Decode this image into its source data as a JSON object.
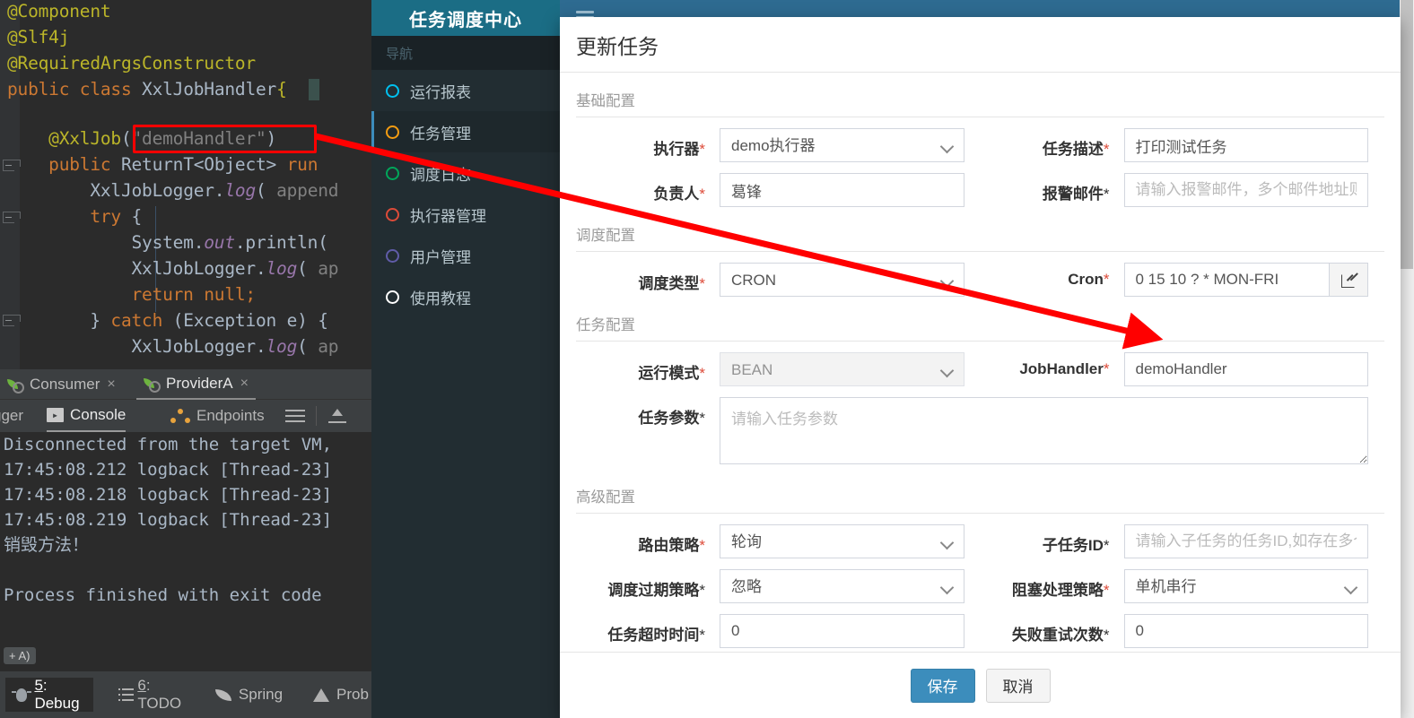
{
  "ide": {
    "code_lines": [
      "@Component",
      "@Slf4j",
      "@RequiredArgsConstructor",
      "public class XxlJobHandler{",
      "",
      "    @XxlJob(\"demoHandler\")",
      "    public ReturnT<Object> run",
      "        XxlJobLogger.log( append",
      "        try {",
      "            System.out.println(",
      "            XxlJobLogger.log( ap",
      "            return null;",
      "        } catch (Exception e) {",
      "            XxlJobLogger.log( ap"
    ],
    "highlighted_token": "\"demoHandler\"",
    "run_tabs": [
      {
        "label": "Consumer",
        "icon": "spring-leaf-icon",
        "active": false
      },
      {
        "label": "ProviderA",
        "icon": "spring-leaf-icon",
        "active": true
      }
    ],
    "tab_close_glyph": "×",
    "sub_tabs": [
      {
        "label": "gger",
        "icon": "",
        "active": false
      },
      {
        "label": "Console",
        "icon": "console-icon",
        "active": true
      },
      {
        "label": "Endpoints",
        "icon": "endpoints-icon",
        "active": false
      }
    ],
    "console_lines": [
      "Disconnected from the target VM,",
      "17:45:08.212 logback [Thread-23]",
      "17:45:08.218 logback [Thread-23]",
      "17:45:08.219 logback [Thread-23]",
      "销毁方法！",
      "",
      "Process finished with exit code"
    ],
    "hint_chip": "+ A)",
    "status_items": [
      {
        "num": "5",
        "label": ": Debug",
        "icon": "bug-icon",
        "active": true
      },
      {
        "num": "6",
        "label": ": TODO",
        "icon": "todo-icon",
        "active": false
      },
      {
        "num": "",
        "label": "Spring",
        "icon": "leaf-icon",
        "active": false
      },
      {
        "num": "",
        "label": "Prob",
        "icon": "warning-icon",
        "active": false
      }
    ]
  },
  "webapp": {
    "brand": "任务调度中心",
    "nav_header": "导航",
    "nav_items": [
      {
        "label": "运行报表",
        "color": "#00c0ef",
        "active": false
      },
      {
        "label": "任务管理",
        "color": "#f39c12",
        "active": true
      },
      {
        "label": "调度日志",
        "color": "#00a65a",
        "active": false
      },
      {
        "label": "执行器管理",
        "color": "#dd4b39",
        "active": false
      },
      {
        "label": "用户管理",
        "color": "#605ca8",
        "active": false
      },
      {
        "label": "使用教程",
        "color": "#ffffff",
        "active": false
      }
    ],
    "menu_icon": "hamburger-icon"
  },
  "modal": {
    "title": "更新任务",
    "sections": [
      {
        "legend": "基础配置"
      },
      {
        "legend": "调度配置"
      },
      {
        "legend": "任务配置"
      },
      {
        "legend": "高级配置"
      }
    ],
    "fields": {
      "executor": {
        "label": "执行器",
        "req": "*",
        "req_red": true,
        "value": "demo执行器"
      },
      "job_desc": {
        "label": "任务描述",
        "req": "*",
        "req_red": true,
        "value": "打印测试任务",
        "placeholder": ""
      },
      "owner": {
        "label": "负责人",
        "req": "*",
        "req_red": true,
        "value": "葛锋",
        "placeholder": ""
      },
      "alarm_email": {
        "label": "报警邮件",
        "req": "*",
        "req_red": false,
        "value": "",
        "placeholder": "请输入报警邮件，多个邮件地址则逗号分隔"
      },
      "schedule_type": {
        "label": "调度类型",
        "req": "*",
        "req_red": true,
        "value": "CRON"
      },
      "cron": {
        "label": "Cron",
        "req": "*",
        "req_red": true,
        "value": "0 15 10 ? * MON-FRI",
        "edit_icon": "pencil-icon"
      },
      "run_mode": {
        "label": "运行模式",
        "req": "*",
        "req_red": true,
        "value": "BEAN",
        "disabled": true
      },
      "job_handler": {
        "label": "JobHandler",
        "req": "*",
        "req_red": true,
        "value": "demoHandler",
        "placeholder": ""
      },
      "job_params": {
        "label": "任务参数",
        "req": "*",
        "req_red": false,
        "value": "",
        "placeholder": "请输入任务参数"
      },
      "route_strategy": {
        "label": "路由策略",
        "req": "*",
        "req_red": true,
        "value": "轮询"
      },
      "child_job_id": {
        "label": "子任务ID",
        "req": "*",
        "req_red": false,
        "value": "",
        "placeholder": "请输入子任务的任务ID,如存在多个则逗号分隔"
      },
      "misfire_strategy": {
        "label": "调度过期策略",
        "req": "*",
        "req_red": false,
        "value": "忽略"
      },
      "block_strategy": {
        "label": "阻塞处理策略",
        "req": "*",
        "req_red": true,
        "value": "单机串行"
      },
      "job_timeout": {
        "label": "任务超时时间",
        "req": "*",
        "req_red": false,
        "value": "0"
      },
      "retry_count": {
        "label": "失败重试次数",
        "req": "*",
        "req_red": false,
        "value": "0"
      }
    },
    "footer": {
      "save_label": "保存",
      "cancel_label": "取消"
    }
  },
  "annotation": {
    "arrow_color": "#ff0000",
    "highlight_color": "#ff0000"
  }
}
